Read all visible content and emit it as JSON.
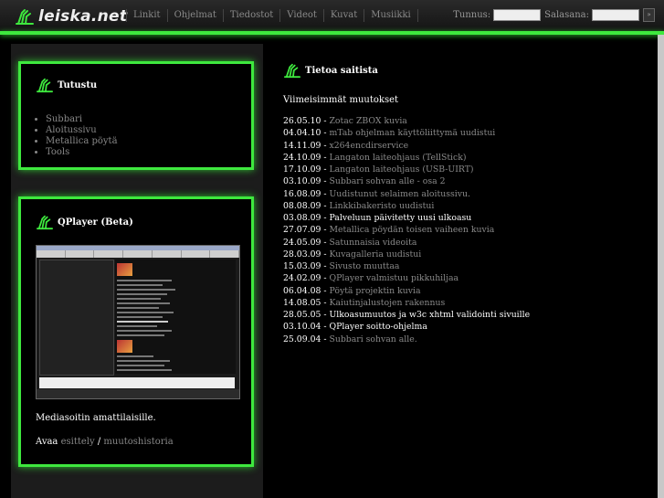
{
  "site": {
    "logo_text": "leiska.net"
  },
  "nav": [
    "Linkit",
    "Ohjelmat",
    "Tiedostot",
    "Videot",
    "Kuvat",
    "Musiikki"
  ],
  "login": {
    "user_label": "Tunnus:",
    "pass_label": "Salasana:",
    "submit": "»"
  },
  "tutustu": {
    "title": "Tutustu",
    "links": [
      "Subbari",
      "Aloitussivu",
      "Metallica pöytä",
      "Tools"
    ]
  },
  "qplayer": {
    "title": "QPlayer (Beta)",
    "description": "Mediasoitin amattilaisille.",
    "open_label": "Avaa",
    "link1": "esittely",
    "separator": "/",
    "link2": "muutoshistoria"
  },
  "about": {
    "title": "Tietoa saitista",
    "subtitle": "Viimeisimmät muutokset"
  },
  "changes": [
    {
      "date": "26.05.10 -",
      "text": "Zotac ZBOX kuvia",
      "highlight": false
    },
    {
      "date": "04.04.10 -",
      "text": "mTab ohjelman käyttöliittymä uudistui",
      "highlight": false
    },
    {
      "date": "14.11.09 -",
      "text": "x264encdirservice",
      "highlight": false
    },
    {
      "date": "24.10.09 -",
      "text": "Langaton laiteohjaus (TellStick)",
      "highlight": false
    },
    {
      "date": "17.10.09 -",
      "text": "Langaton laiteohjaus (USB-UIRT)",
      "highlight": false
    },
    {
      "date": "03.10.09 -",
      "text": "Subbari sohvan alle - osa 2",
      "highlight": false
    },
    {
      "date": "16.08.09 -",
      "text": "Uudistunut selaimen aloitussivu.",
      "highlight": false
    },
    {
      "date": "08.08.09 -",
      "text": "Linkkibakeristo uudistui",
      "highlight": false
    },
    {
      "date": "03.08.09 -",
      "text": "Palveluun päivitetty uusi ulkoasu",
      "highlight": true
    },
    {
      "date": "27.07.09 -",
      "text": "Metallica pöydän toisen vaiheen kuvia",
      "highlight": false
    },
    {
      "date": "24.05.09 -",
      "text": "Satunnaisia videoita",
      "highlight": false
    },
    {
      "date": "28.03.09 -",
      "text": "Kuvagalleria uudistui",
      "highlight": false
    },
    {
      "date": "15.03.09 -",
      "text": "Sivusto muuttaa",
      "highlight": false
    },
    {
      "date": "24.02.09 -",
      "text": "QPlayer valmistuu pikkuhiljaa",
      "highlight": false
    },
    {
      "date": "06.04.08 -",
      "text": "Pöytä projektin kuvia",
      "highlight": false
    },
    {
      "date": "14.08.05 -",
      "text": "Kaiutinjalustojen rakennus",
      "highlight": false
    },
    {
      "date": "28.05.05 -",
      "text": "Ulkoasumuutos ja w3c xhtml validointi sivuille",
      "highlight": true
    },
    {
      "date": "03.10.04 -",
      "text": "QPlayer soitto-ohjelma",
      "highlight": true
    },
    {
      "date": "25.09.04 -",
      "text": "Subbari sohvan alle.",
      "highlight": false
    }
  ],
  "colors": {
    "accent_green": "#3ee83e",
    "link_gray": "#8a8a8a",
    "background": "#000000"
  }
}
